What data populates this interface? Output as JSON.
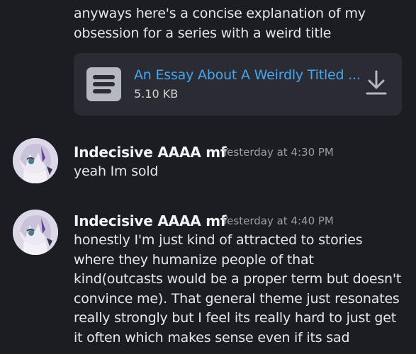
{
  "continuation": {
    "text": "anyways here's a concise explanation of my obsession for a series with a weird title"
  },
  "attachment": {
    "icon": "document-icon",
    "file_name": "An Essay About A Weirdly Titled ...",
    "file_size": "5.10 KB",
    "download_icon": "download-icon",
    "link_color": "#43a7f2"
  },
  "messages": [
    {
      "username": "Indecisive AAAA mf",
      "timestamp": "Yesterday at 4:30 PM",
      "text": "yeah Im sold"
    },
    {
      "username": "Indecisive AAAA mf",
      "timestamp": "Yesterday at 4:40 PM",
      "text": "honestly I'm just kind of attracted to stories where they humanize people of that kind(outcasts would be a proper term but doesn't convince me). That general theme just resonates really strongly but I feel its really hard to just get it often which makes sense even if its sad"
    }
  ],
  "colors": {
    "background": "#1c1d23",
    "attachment_bg": "#2b2c33",
    "username": "#f2f3f5",
    "timestamp": "#9a9ca6"
  }
}
